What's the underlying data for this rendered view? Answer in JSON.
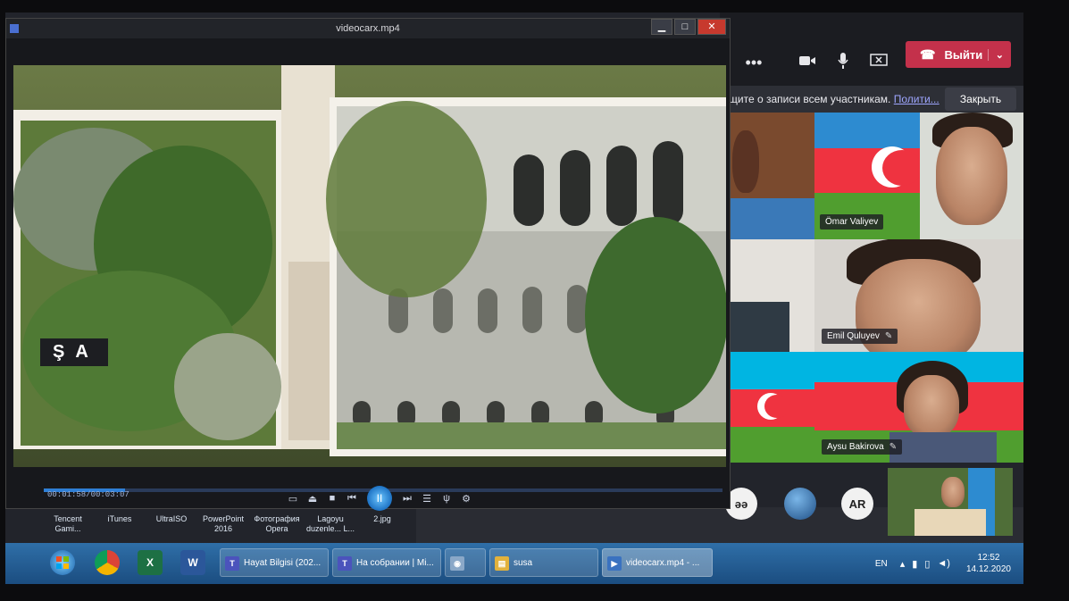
{
  "player": {
    "title": "videocarx.mp4",
    "window_buttons": [
      "▁",
      "□",
      "✕"
    ],
    "caption": "ŞA",
    "time": "00:01:58/00:03:07",
    "progress": 0.12,
    "controls": [
      "▭",
      "⏏",
      "■",
      "⏮",
      "II",
      "⏭",
      "☰",
      "ψ",
      "⚙"
    ]
  },
  "teams": {
    "more_label": "•••",
    "leave_label": "Выйти",
    "banner_text": "щите о записи всем участникам.",
    "banner_link": "Полити...",
    "close_label": "Закрыть",
    "participants": [
      {
        "name": "Ömar Valiyev"
      },
      {
        "name": "Emil Quluyev"
      },
      {
        "name": "Aysu Bakirova"
      }
    ],
    "avatars": [
      "әә",
      "AR"
    ]
  },
  "desktop_icons": [
    "Tencent Gami...",
    "iTunes",
    "UltraISO",
    "PowerPoint 2016",
    "Фотография Opera",
    "Lagoyu duzenle... L...",
    "2.jpg"
  ],
  "taskbar": {
    "pinned": [
      "X",
      "W"
    ],
    "windows": [
      {
        "label": "Hayat Bilgisi (202...",
        "icon": "T",
        "color": "#4b53bc"
      },
      {
        "label": "На собрании | Mi...",
        "icon": "T",
        "color": "#4b53bc"
      },
      {
        "label": "",
        "icon": "◉",
        "color": "#8aa8c8"
      },
      {
        "label": "susa",
        "icon": "▤",
        "color": "#e3b23c"
      },
      {
        "label": "videocarx.mp4 - ...",
        "icon": "▶",
        "color": "#3a72c0"
      }
    ],
    "lang": "EN",
    "time": "12:52",
    "date": "14.12.2020"
  }
}
